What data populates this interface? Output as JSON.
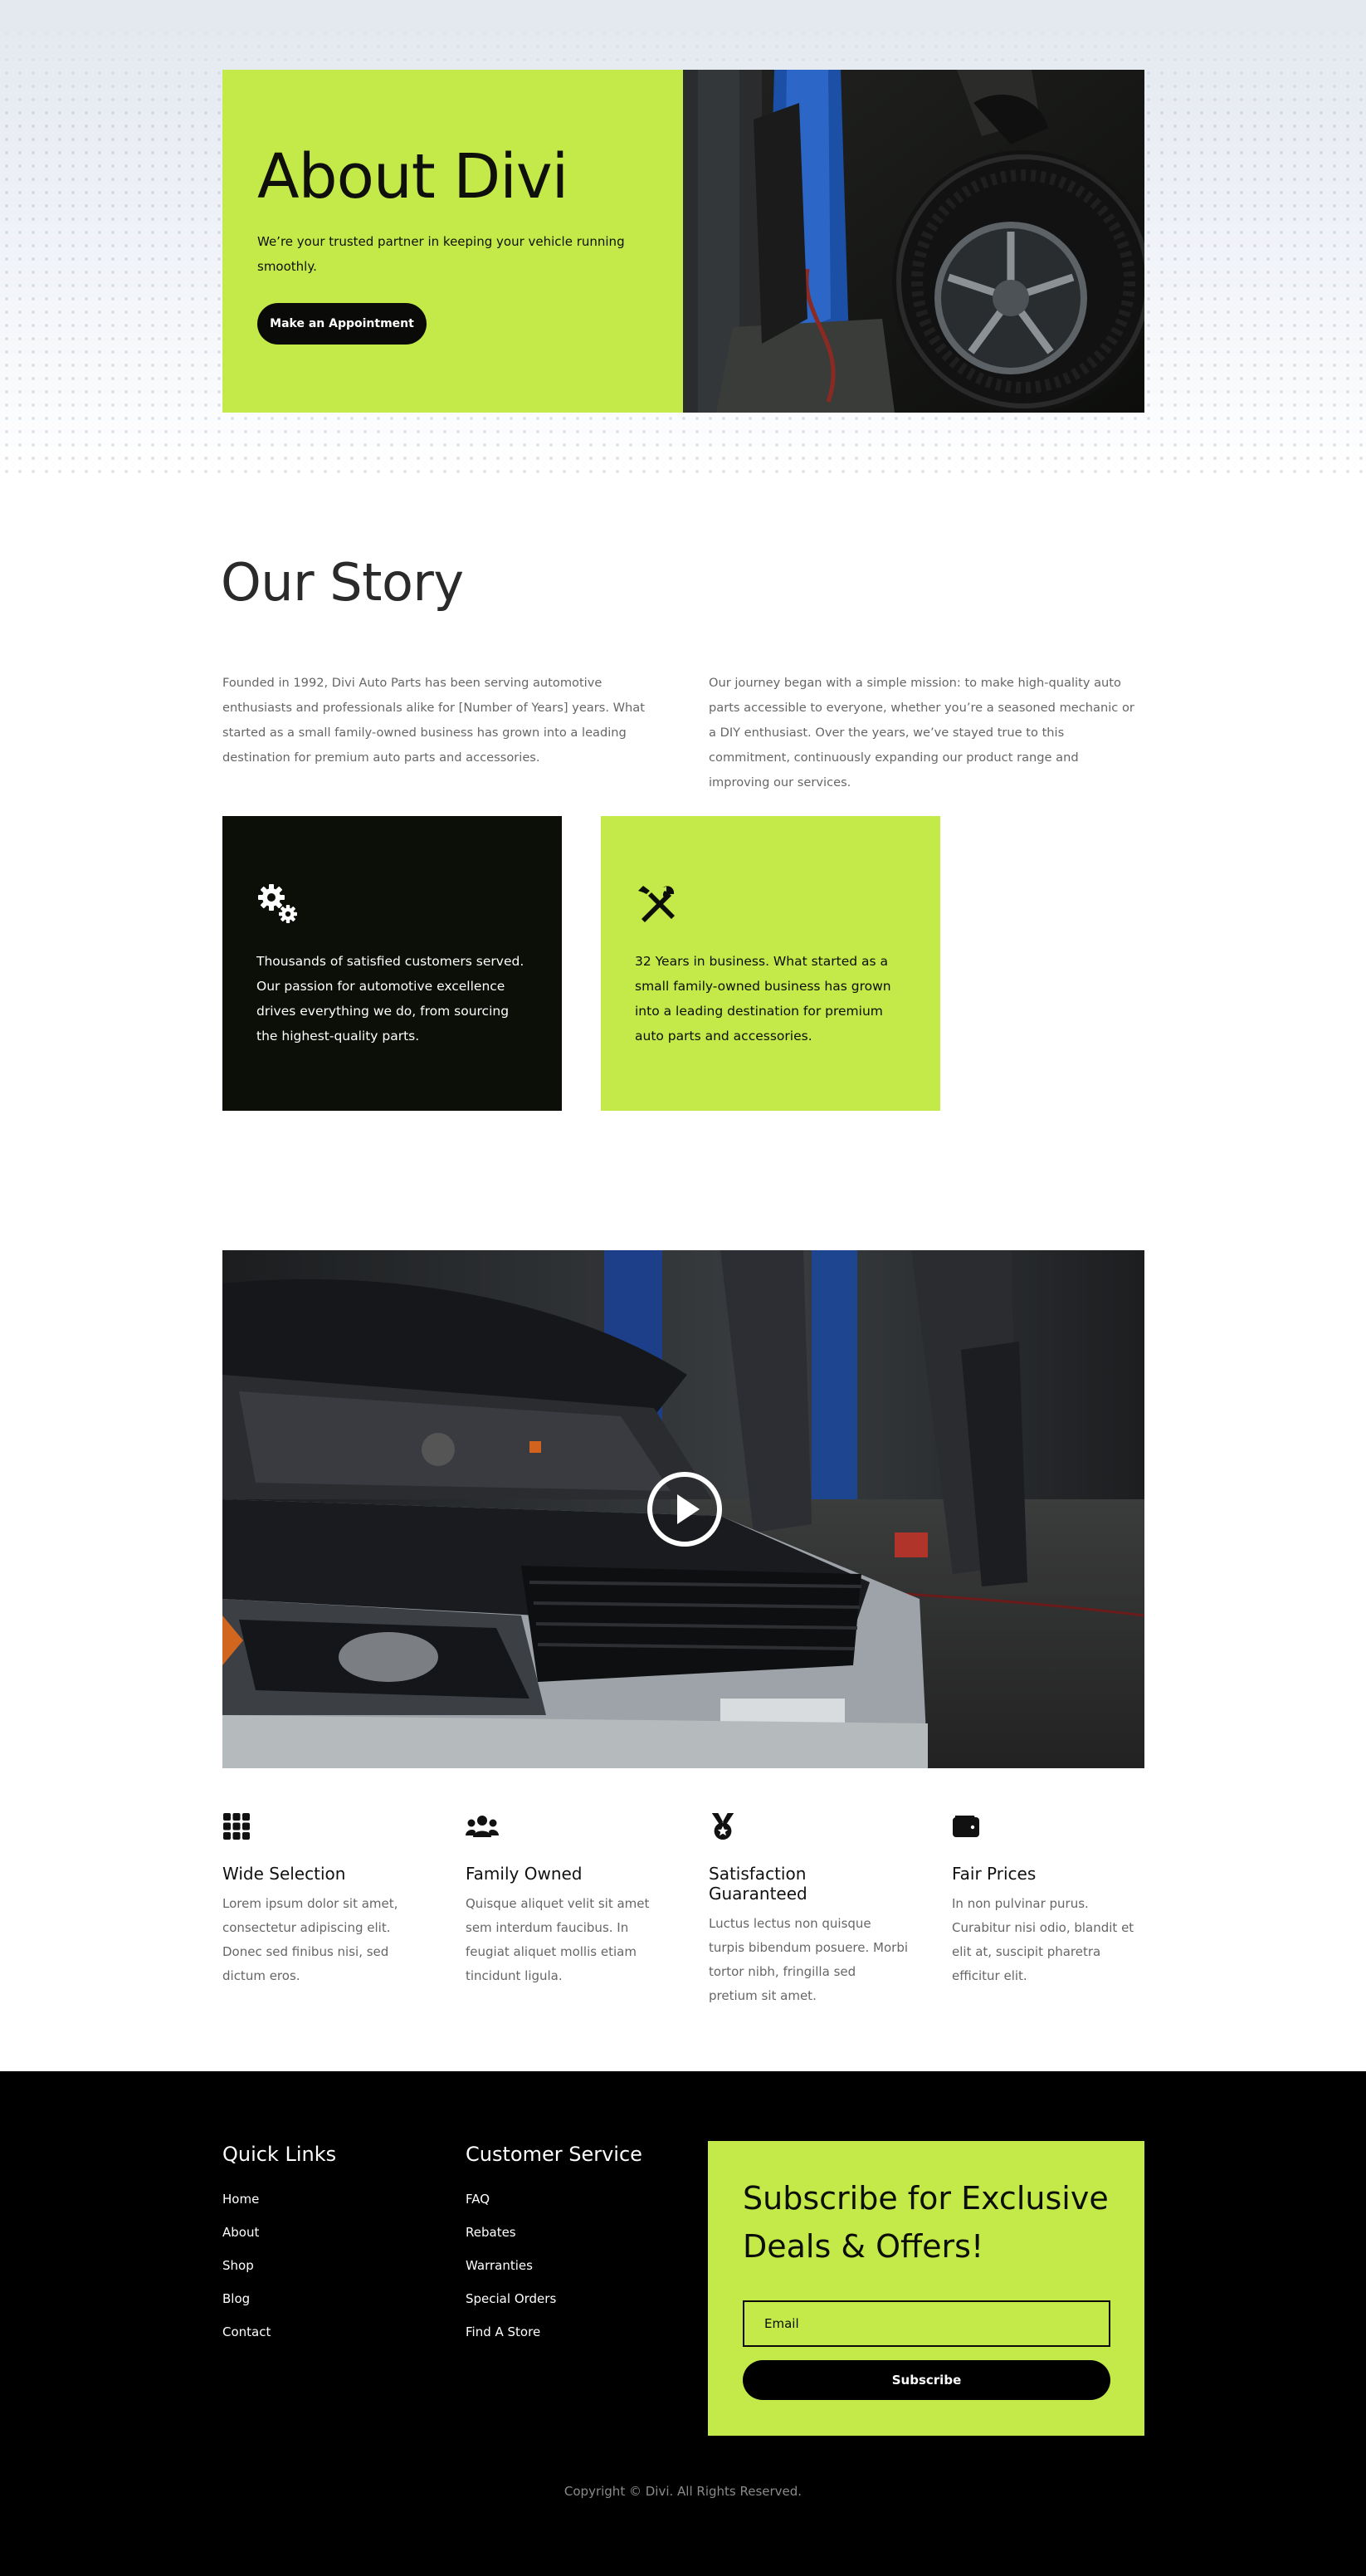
{
  "hero": {
    "title": "About Divi",
    "subtitle": "We’re your trusted partner in keeping your vehicle running smoothly.",
    "button_label": "Make an Appointment"
  },
  "story": {
    "title": "Our Story",
    "paragraph_left": "Founded in 1992, Divi Auto Parts has been serving automotive enthusiasts and professionals alike for [Number of Years] years. What started as a small family-owned business has grown into a leading destination for premium auto parts and accessories.",
    "paragraph_right": "Our journey began with a simple mission: to make high-quality auto parts accessible to everyone, whether you’re a seasoned mechanic or a DIY enthusiast. Over the years, we’ve stayed true to this commitment, continuously expanding our product range and improving our services."
  },
  "features": [
    {
      "icon": "gears-icon",
      "text": "Thousands of satisfied customers served. Our passion for automotive excellence drives everything we do, from sourcing the highest-quality parts."
    },
    {
      "icon": "tools-icon",
      "text": "32 Years in business. What started as a small family-owned business has grown into a leading destination for premium auto parts and accessories."
    }
  ],
  "video": {
    "icon": "play-icon"
  },
  "benefits": [
    {
      "icon": "grid-icon",
      "title": "Wide Selection",
      "text": "Lorem ipsum dolor sit amet, consectetur adipiscing elit. Donec sed finibus nisi, sed dictum eros."
    },
    {
      "icon": "users-icon",
      "title": "Family Owned",
      "text": "Quisque aliquet velit sit amet sem interdum faucibus. In feugiat aliquet mollis etiam tincidunt ligula."
    },
    {
      "icon": "medal-icon",
      "title": "Satisfaction Guaranteed",
      "text": "Luctus lectus non quisque turpis bibendum posuere. Morbi tortor nibh, fringilla sed pretium sit amet."
    },
    {
      "icon": "wallet-icon",
      "title": "Fair Prices",
      "text": "In non pulvinar purus. Curabitur nisi odio, blandit et elit at, suscipit pharetra efficitur elit."
    }
  ],
  "footer": {
    "quick_links_title": "Quick Links",
    "quick_links": [
      "Home",
      "About",
      "Shop",
      "Blog",
      "Contact"
    ],
    "customer_service_title": "Customer Service",
    "customer_service_links": [
      "FAQ",
      "Rebates",
      "Warranties",
      "Special Orders",
      "Find A Store"
    ],
    "subscribe_title": "Subscribe for Exclusive Deals & Offers!",
    "email_placeholder": "Email",
    "subscribe_button": "Subscribe",
    "copyright": "Copyright © Divi. All Rights Reserved."
  },
  "colors": {
    "accent": "#c3ea48",
    "dark": "#0c0e08"
  }
}
